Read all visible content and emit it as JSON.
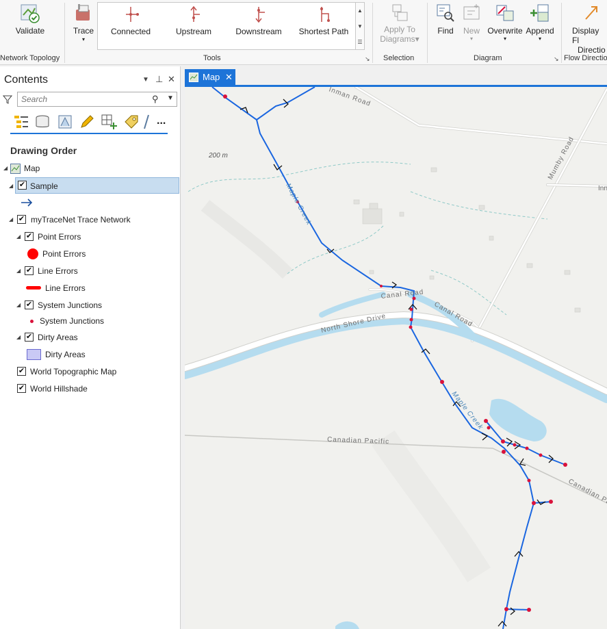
{
  "ribbon": {
    "validate_label": "Validate",
    "network_topology_group": "Network Topology",
    "trace_label": "Trace",
    "tools_group": "Tools",
    "gallery": [
      "Connected",
      "Upstream",
      "Downstream",
      "Shortest Path"
    ],
    "apply_to_diagrams_label_1": "Apply To",
    "apply_to_diagrams_label_2": "Diagrams",
    "selection_group": "Selection",
    "find_label": "Find",
    "new_label": "New",
    "overwrite_label": "Overwrite",
    "append_label": "Append",
    "diagram_group": "Diagram",
    "display_flow_label_1": "Display Fl",
    "display_flow_label_2": "Directio",
    "flow_direction_group": "Flow Directio"
  },
  "contents": {
    "title": "Contents",
    "search_placeholder": "Search",
    "drawing_order": "Drawing Order",
    "more_label": "...",
    "layers": {
      "map": "Map",
      "sample": "Sample",
      "trace_network": "myTraceNet Trace Network",
      "point_errors": "Point Errors",
      "point_errors_symbol": "Point Errors",
      "line_errors": "Line Errors",
      "line_errors_symbol": "Line Errors",
      "system_junctions": "System Junctions",
      "system_junctions_symbol": "System Junctions",
      "dirty_areas": "Dirty Areas",
      "dirty_areas_symbol": "Dirty Areas",
      "world_topo": "World Topographic Map",
      "world_hillshade": "World Hillshade"
    }
  },
  "map": {
    "tab_label": "Map",
    "labels": {
      "inman_road": "Inman Road",
      "scale_200m": "200 m",
      "mumby_road": "Mumby Road",
      "inn": "Inn",
      "maple_creek_upper": "Maple Creek",
      "canal_road_1": "Canal Road",
      "canal_road_2": "Canal Road",
      "north_shore_drive": "North Shore Drive",
      "maple_creek_lower": "Maple Creek",
      "canadian_pacific_1": "Canadian Pacific",
      "canadian_pacific_2": "Canadian Paci"
    }
  },
  "colors": {
    "accent": "#1d74d8",
    "trace_line": "#1a66e0",
    "error_point": "#d9123b",
    "water": "#b5dcef",
    "road": "#ffffff"
  }
}
